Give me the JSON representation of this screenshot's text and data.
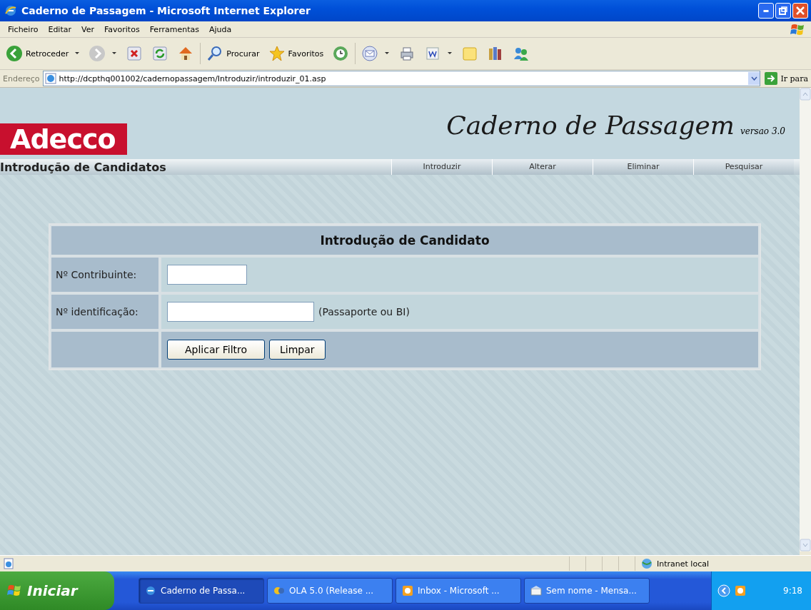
{
  "window": {
    "title": "Caderno de Passagem - Microsoft Internet Explorer"
  },
  "menu_bar": [
    "Ficheiro",
    "Editar",
    "Ver",
    "Favoritos",
    "Ferramentas",
    "Ajuda"
  ],
  "toolbar": [
    {
      "label": "Retroceder",
      "dropdown": true
    },
    {
      "dropdown": true
    },
    {
      "dropdown": false
    },
    {
      "dropdown": false
    },
    {
      "dropdown": false
    },
    {
      "label": "Procurar",
      "dropdown": false
    },
    {
      "label": "Favoritos",
      "dropdown": false
    },
    {
      "dropdown": false
    },
    {
      "dropdown": true
    },
    {
      "dropdown": false
    },
    {
      "dropdown": true
    },
    {
      "dropdown": false
    },
    {
      "dropdown": false
    },
    {
      "dropdown": false
    }
  ],
  "address_bar": {
    "label": "Endereço",
    "url": "http://dcpthq001002/cadernopassagem/Introduzir/introduzir_01.asp",
    "go": "Ir para"
  },
  "page": {
    "logo": "Adecco",
    "app_title": "Caderno de Passagem",
    "version": "versao 3.0",
    "section_title": "Introdução de Candidatos",
    "nav": [
      {
        "label": "Introduzir"
      },
      {
        "label": "Alterar"
      },
      {
        "label": "Eliminar"
      },
      {
        "label": "Pesquisar"
      }
    ],
    "form": {
      "title": "Introdução de Candidato",
      "fields": [
        {
          "label": "Nº Contribuinte:"
        },
        {
          "label": "Nº identificação:",
          "hint": "(Passaporte ou BI)"
        }
      ],
      "buttons": [
        "Aplicar Filtro",
        "Limpar"
      ]
    }
  },
  "status_bar": {
    "zone": "Intranet local"
  },
  "taskbar": {
    "start": "Iniciar",
    "tasks": [
      {
        "label": "Caderno de Passa...",
        "selected": true
      },
      {
        "label": "OLA 5.0 (Release ...",
        "selected": false
      },
      {
        "label": "Inbox - Microsoft ...",
        "selected": false
      },
      {
        "label": "Sem nome - Mensa...",
        "selected": false
      }
    ],
    "clock": "9:18"
  }
}
